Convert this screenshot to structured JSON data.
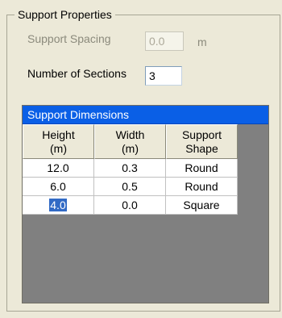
{
  "group": {
    "title": "Support Properties"
  },
  "support_spacing": {
    "label": "Support Spacing",
    "value": "0.0",
    "unit": "m"
  },
  "number_of_sections": {
    "label": "Number of Sections",
    "value": "3"
  },
  "grid": {
    "caption": "Support Dimensions",
    "headers": [
      {
        "line1": "Height",
        "line2": "(m)"
      },
      {
        "line1": "Width",
        "line2": "(m)"
      },
      {
        "line1": "Support",
        "line2": "Shape"
      }
    ],
    "rows": [
      {
        "height": "12.0",
        "width": "0.3",
        "shape": "Round"
      },
      {
        "height": "6.0",
        "width": "0.5",
        "shape": "Round"
      },
      {
        "height": "4.0",
        "width": "0.0",
        "shape": "Square"
      }
    ]
  }
}
